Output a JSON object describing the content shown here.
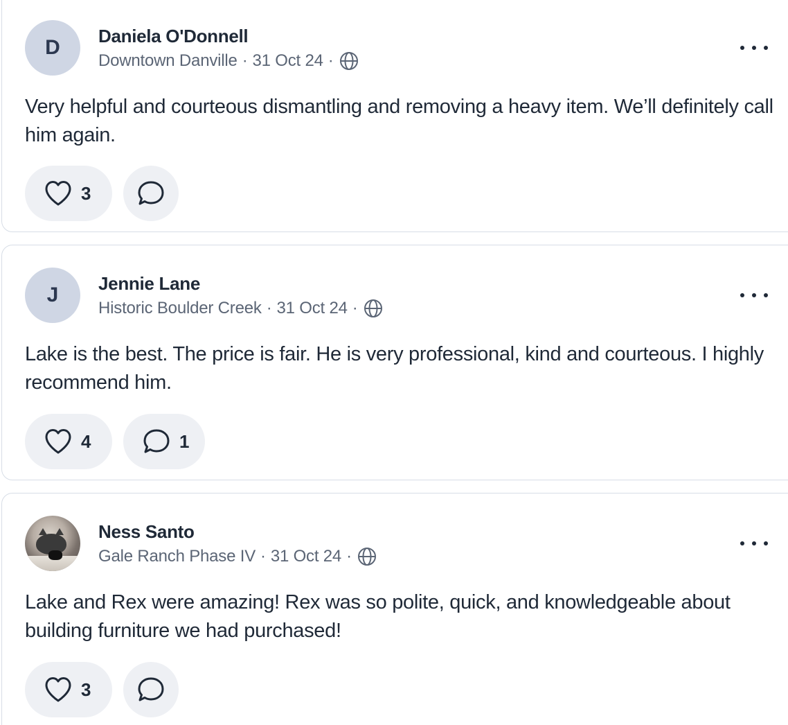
{
  "posts": [
    {
      "author": "Daniela O'Donnell",
      "avatar_initial": "D",
      "neighborhood": "Downtown Danville",
      "date": "31 Oct 24",
      "separator": "·",
      "visibility_icon": "globe-icon",
      "text": "Very helpful and courteous dismantling and removing a heavy item. We’ll definitely call him again.",
      "likes": "3",
      "comments": ""
    },
    {
      "author": "Jennie Lane",
      "avatar_initial": "J",
      "neighborhood": "Historic Boulder Creek",
      "date": "31 Oct 24",
      "separator": "·",
      "visibility_icon": "globe-icon",
      "text": "Lake is the best. The price is fair. He is very professional, kind and courteous. I highly recommend him.",
      "likes": "4",
      "comments": "1"
    },
    {
      "author": "Ness Santo",
      "avatar_initial": "",
      "avatar_photo": "cat-photo",
      "neighborhood": "Gale Ranch Phase IV",
      "date": "31 Oct 24",
      "separator": "·",
      "visibility_icon": "globe-icon",
      "text": "Lake and Rex were amazing! Rex was so polite, quick, and knowledgeable about building furniture we had purchased!",
      "likes": "3",
      "comments": ""
    }
  ],
  "icons": {
    "like": "heart-icon",
    "comment": "speech-bubble-icon",
    "more": "more-options-icon"
  },
  "colors": {
    "avatar_bg": "#cfd6e4",
    "pill_bg": "#eef0f4",
    "text_primary": "#1f2937",
    "text_secondary": "#5b6575",
    "card_border": "#d7dde6"
  }
}
